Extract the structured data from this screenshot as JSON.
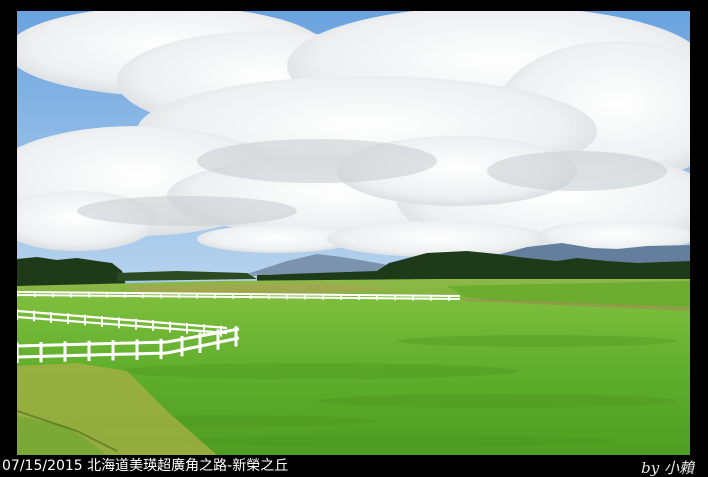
{
  "caption": "07/15/2015 北海道美瑛超廣角之路-新榮之丘",
  "signature": "by 小賴",
  "colors": {
    "frame": "#000000",
    "sky": "#7fb3e6",
    "cloud": "#f4f4f2",
    "field": "#5cae2c",
    "fence": "#ffffff",
    "trees": "#1f3b1a",
    "mountains": "#6f8aa8"
  }
}
